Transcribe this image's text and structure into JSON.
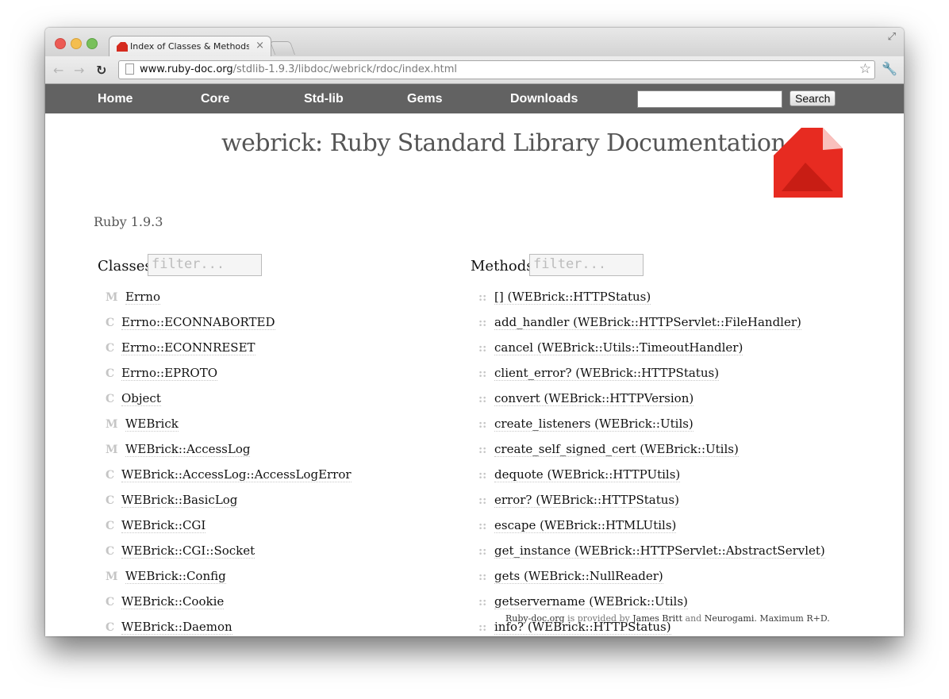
{
  "browser": {
    "tab_title": "Index of Classes & Methods i",
    "tab_close": "×",
    "url_host": "www.ruby-doc.org",
    "url_path": "/stdlib-1.9.3/libdoc/webrick/rdoc/index.html"
  },
  "site_nav": {
    "items": [
      "Home",
      "Core",
      "Std-lib",
      "Gems",
      "Downloads"
    ],
    "search_button": "Search"
  },
  "header": {
    "title": "webrick: Ruby Standard Library Documentation",
    "version": "Ruby 1.9.3"
  },
  "classes": {
    "label": "Classes",
    "filter_placeholder": "filter...",
    "items": [
      {
        "type": "M",
        "name": "Errno"
      },
      {
        "type": "C",
        "name": "Errno::ECONNABORTED"
      },
      {
        "type": "C",
        "name": "Errno::ECONNRESET"
      },
      {
        "type": "C",
        "name": "Errno::EPROTO"
      },
      {
        "type": "C",
        "name": "Object"
      },
      {
        "type": "M",
        "name": "WEBrick"
      },
      {
        "type": "M",
        "name": "WEBrick::AccessLog"
      },
      {
        "type": "C",
        "name": "WEBrick::AccessLog::AccessLogError"
      },
      {
        "type": "C",
        "name": "WEBrick::BasicLog"
      },
      {
        "type": "C",
        "name": "WEBrick::CGI"
      },
      {
        "type": "C",
        "name": "WEBrick::CGI::Socket"
      },
      {
        "type": "M",
        "name": "WEBrick::Config"
      },
      {
        "type": "C",
        "name": "WEBrick::Cookie"
      },
      {
        "type": "C",
        "name": "WEBrick::Daemon"
      }
    ]
  },
  "methods": {
    "label": "Methods",
    "filter_placeholder": "filter...",
    "marker": "::",
    "items": [
      "[] (WEBrick::HTTPStatus)",
      "add_handler (WEBrick::HTTPServlet::FileHandler)",
      "cancel (WEBrick::Utils::TimeoutHandler)",
      "client_error? (WEBrick::HTTPStatus)",
      "convert (WEBrick::HTTPVersion)",
      "create_listeners (WEBrick::Utils)",
      "create_self_signed_cert (WEBrick::Utils)",
      "dequote (WEBrick::HTTPUtils)",
      "error? (WEBrick::HTTPStatus)",
      "escape (WEBrick::HTMLUtils)",
      "get_instance (WEBrick::HTTPServlet::AbstractServlet)",
      "gets (WEBrick::NullReader)",
      "getservername (WEBrick::Utils)",
      "info? (WEBrick::HTTPStatus)"
    ]
  },
  "footer": {
    "site": "Ruby-doc.org",
    "provided": " is provided by ",
    "author": "James Britt",
    "and": " and ",
    "company": "Neurogami",
    "tagline": ". Maximum R+D."
  }
}
